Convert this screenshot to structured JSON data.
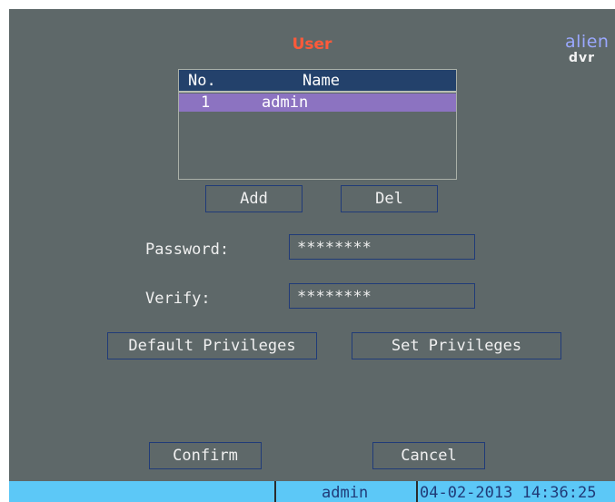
{
  "window": {
    "title": "User",
    "logo_line1": "alien",
    "logo_line2": "dvr"
  },
  "user_list": {
    "headers": {
      "no": "No.",
      "name": "Name"
    },
    "rows": [
      {
        "no": "1",
        "name": "admin"
      }
    ]
  },
  "buttons": {
    "add": "Add",
    "del": "Del",
    "default_privileges": "Default Privileges",
    "set_privileges": "Set Privileges",
    "confirm": "Confirm",
    "cancel": "Cancel"
  },
  "form": {
    "password_label": "Password:",
    "password_value": "********",
    "verify_label": "Verify:",
    "verify_value": "********"
  },
  "status_bar": {
    "user": "admin",
    "datetime": "04-02-2013 14:36:25"
  },
  "colors": {
    "panel_bg": "#5e6869",
    "title": "#ff5a3a",
    "header_bg": "#23416b",
    "selected_row": "#8c73c1",
    "status_bar": "#5cc8f7"
  }
}
